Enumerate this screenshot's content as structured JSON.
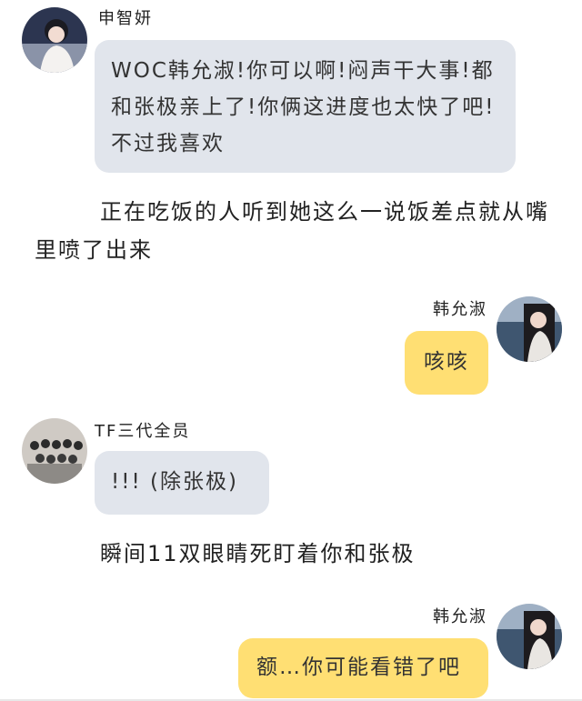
{
  "messages": [
    {
      "sender": "申智妍",
      "text": "WOC韩允淑!你可以啊!闷声干大事!都和张极亲上了!你俩这进度也太快了吧!不过我喜欢"
    },
    {
      "sender": "韩允淑",
      "text": "咳咳"
    },
    {
      "sender": "TF三代全员",
      "text": "!!! (除张极)"
    },
    {
      "sender": "韩允淑",
      "text": "额…你可能看错了吧"
    }
  ],
  "narration": [
    "正在吃饭的人听到她这么一说饭差点就从嘴里喷了出来",
    "瞬间11双眼睛死盯着你和张极"
  ],
  "colors": {
    "left_bubble": "#e1e5ec",
    "right_bubble": "#ffdf73"
  }
}
